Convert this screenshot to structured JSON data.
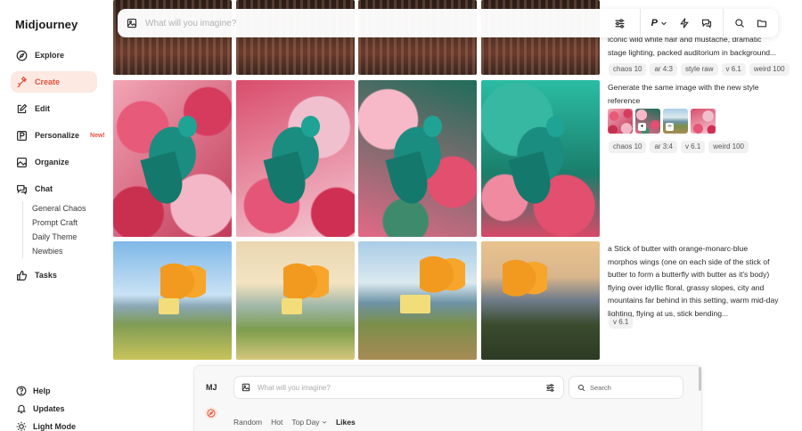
{
  "app": {
    "title": "Midjourney"
  },
  "sidebar": {
    "items": [
      {
        "label": "Explore",
        "icon": "compass-icon"
      },
      {
        "label": "Create",
        "icon": "paintbrush-icon"
      },
      {
        "label": "Edit",
        "icon": "edit-icon"
      },
      {
        "label": "Personalize",
        "icon": "personalize-icon",
        "badge": "New!"
      },
      {
        "label": "Organize",
        "icon": "image-icon"
      },
      {
        "label": "Chat",
        "icon": "chat-icon"
      }
    ],
    "chat_channels": [
      "General Chaos",
      "Prompt Craft",
      "Daily Theme",
      "Newbies"
    ],
    "tasks": "Tasks",
    "bottom": [
      {
        "label": "Help",
        "icon": "help-icon"
      },
      {
        "label": "Updates",
        "icon": "bell-icon"
      },
      {
        "label": "Light Mode",
        "icon": "sun-icon"
      }
    ]
  },
  "topbar": {
    "placeholder": "What will you imagine?",
    "personalize_label": "P"
  },
  "prompts": [
    {
      "text": "iconic wild white hair and mustache, dramatic stage lighting, packed auditorium in background...",
      "chips": [
        "chaos 10",
        "ar 4:3",
        "style raw",
        "v 6.1",
        "weird 100"
      ]
    },
    {
      "text": "Generate the same image with the new style reference",
      "chips": [
        "chaos 10",
        "ar 3:4",
        "v 6.1",
        "weird 100"
      ]
    },
    {
      "text": "a Stick of butter with orange-monarc-blue morphos wings (one on each side of the stick of butter to form a butterfly with butter as it's body) flying over idyllic floral, grassy slopes, city and mountains far behind in this setting, warm mid-day lighting, flying at us, stick bending...",
      "chips": [
        "v 6.1"
      ]
    }
  ],
  "panel": {
    "label": "MJ",
    "placeholder": "What will you imagine?",
    "search_placeholder": "Search",
    "filters": [
      "Random",
      "Hot",
      "Top Day",
      "Likes"
    ]
  },
  "colors": {
    "accent": "#e0523a",
    "accent_bg": "#fde9e2"
  }
}
